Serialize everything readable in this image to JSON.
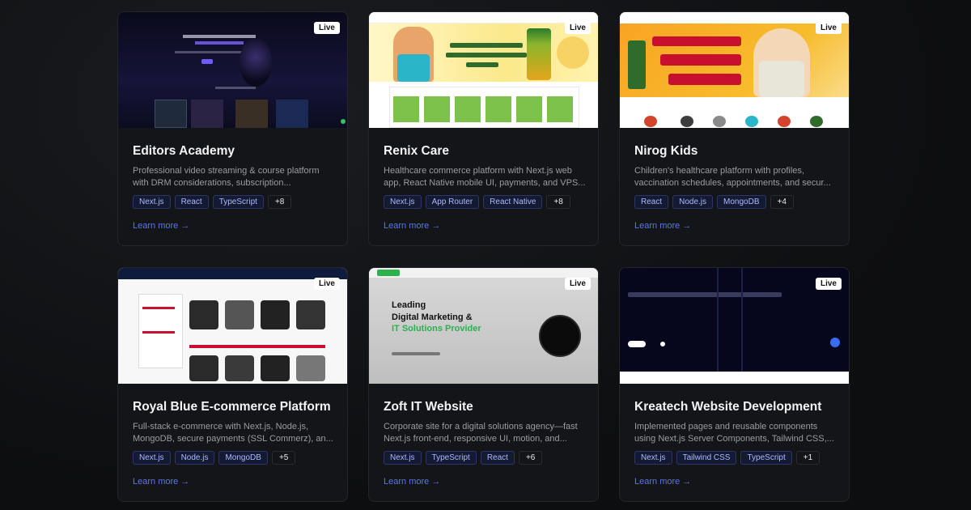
{
  "projects": [
    {
      "live": "Live",
      "title": "Editors Academy",
      "description": "Professional video streaming & course platform with DRM considerations, subscription...",
      "tags": [
        "Next.js",
        "React",
        "TypeScript"
      ],
      "more": "+8",
      "learn": "Learn more →"
    },
    {
      "live": "Live",
      "title": "Renix Care",
      "description": "Healthcare commerce platform with Next.js web app, React Native mobile UI, payments, and VPS...",
      "tags": [
        "Next.js",
        "App Router",
        "React Native"
      ],
      "more": "+8",
      "learn": "Learn more →"
    },
    {
      "live": "Live",
      "title": "Nirog Kids",
      "description": "Children's healthcare platform with profiles, vaccination schedules, appointments, and secur...",
      "tags": [
        "React",
        "Node.js",
        "MongoDB"
      ],
      "more": "+4",
      "learn": "Learn more →"
    },
    {
      "live": "Live",
      "title": "Royal Blue E-commerce Platform",
      "description": "Full-stack e-commerce with Next.js, Node.js, MongoDB, secure payments (SSL Commerz), an...",
      "tags": [
        "Next.js",
        "Node.js",
        "MongoDB"
      ],
      "more": "+5",
      "learn": "Learn more →"
    },
    {
      "live": "Live",
      "title": "Zoft IT Website",
      "description": "Corporate site for a digital solutions agency—fast Next.js front-end, responsive UI, motion, and...",
      "tags": [
        "Next.js",
        "TypeScript",
        "React"
      ],
      "more": "+6",
      "learn": "Learn more →",
      "thumb_heading_1": "Leading",
      "thumb_heading_2": "Digital Marketing &",
      "thumb_heading_3": "IT Solutions Provider"
    },
    {
      "live": "Live",
      "title": "Kreatech Website Development",
      "description": "Implemented pages and reusable components using Next.js Server Components, Tailwind CSS,...",
      "tags": [
        "Next.js",
        "Tailwind CSS",
        "TypeScript"
      ],
      "more": "+1",
      "learn": "Learn more →"
    }
  ],
  "colors": {
    "accent": "#5a74f0",
    "tag_text": "#a9b9ff",
    "card_bg": "#141518"
  }
}
